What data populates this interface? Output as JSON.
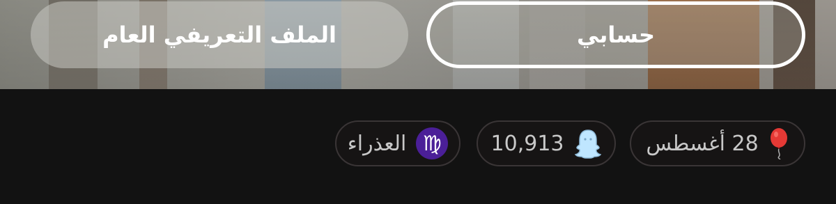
{
  "hero": {
    "public_profile_label": "الملف التعريفي العام",
    "my_account_label": "حسابي"
  },
  "chips": {
    "zodiac": {
      "label": "العذراء",
      "icon": "virgo-icon",
      "glyph": "♍"
    },
    "score": {
      "value": "10,913",
      "icon": "ghost-icon"
    },
    "birthday": {
      "label": "28 أغسطس",
      "icon": "balloon-icon"
    }
  },
  "colors": {
    "background": "#121212",
    "chip_border": "#3a3536",
    "virgo_bg": "#4b1f98",
    "balloon": "#e53935",
    "ghost": "#bfe6ff"
  }
}
